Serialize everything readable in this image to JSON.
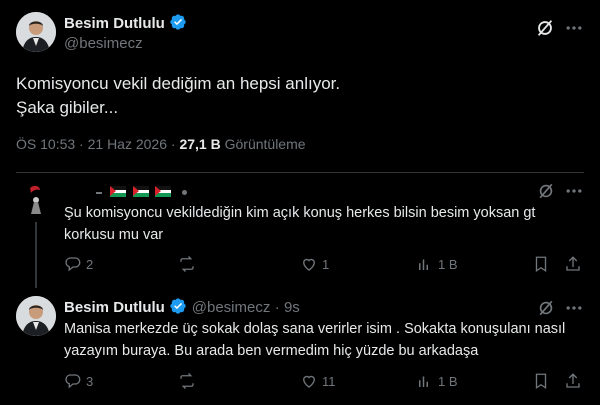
{
  "main_post": {
    "author_name": "Besim Dutlulu",
    "handle": "@besimecz",
    "text_line1": "Komisyoncu vekil dediğim an hepsi anlıyor.",
    "text_line2": "Şaka gibiler...",
    "time": "ÖS 10:53",
    "date": "21 Haz 2026",
    "views_count": "27,1 B",
    "views_label": "Görüntüleme"
  },
  "reply1": {
    "text": "Şu komisyoncu vekildediğin kim açık konuş herkes bilsin besim yoksan gt korkusu mu var",
    "replies": "2",
    "reposts": "",
    "likes": "1",
    "views": "1 B"
  },
  "reply2": {
    "author_name": "Besim Dutlulu",
    "handle": "@besimecz",
    "time_ago": "9s",
    "text": "Manisa merkezde üç sokak dolaş sana verirler isim . Sokakta konuşulanı nasıl yazayım buraya. Bu arada ben vermedim hiç yüzde bu arkadaşa",
    "replies": "3",
    "reposts": "",
    "likes": "11",
    "views": "1 B"
  },
  "colors": {
    "background": "#000000",
    "text": "#e7e9ea",
    "secondary": "#71767b",
    "verified": "#1d9bf0",
    "divider": "#2f3336"
  }
}
